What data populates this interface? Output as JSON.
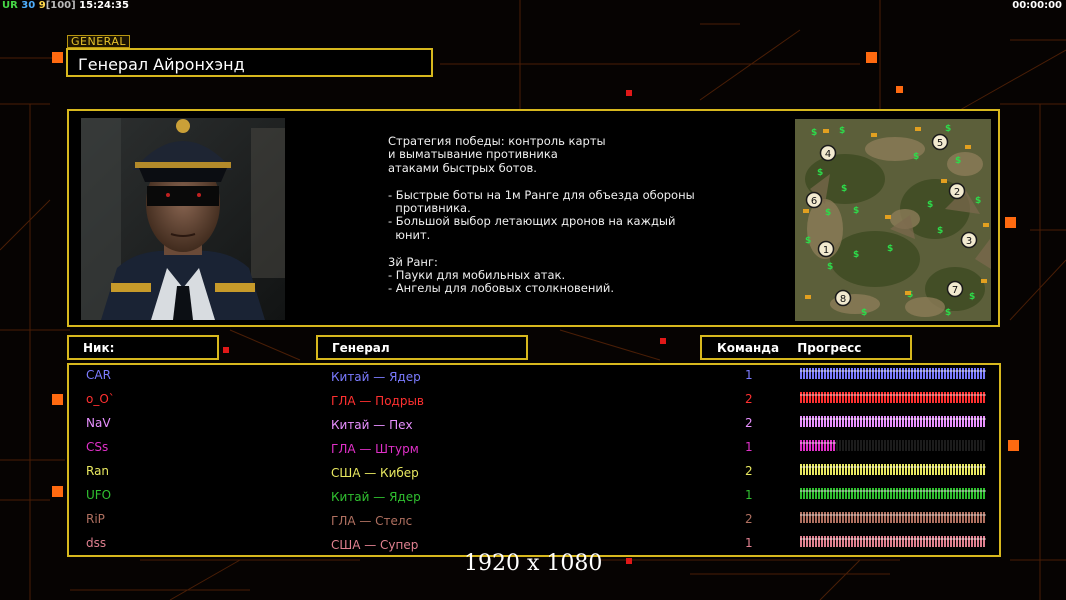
{
  "hud": {
    "segments": [
      {
        "text": "UR",
        "color": "#46d646"
      },
      {
        "text": " 30 ",
        "color": "#4fb0ff"
      },
      {
        "text": "9",
        "color": "#ffd84a"
      },
      {
        "text": "[100]",
        "color": "#bbbbbb"
      },
      {
        "text": " 15:24:35",
        "color": "#ffffff"
      }
    ],
    "timer": "00:00:00"
  },
  "general": {
    "tag": "GENERAL",
    "name": "Генерал Айронхэнд"
  },
  "description": "Стратегия победы: контроль карты\nи выматывание противника\nатаками быстрых ботов.\n\n- Быстрые боты на 1м Ранге для объезда обороны\n  противника.\n- Большой выбор летающих дронов на каждый\n  юнит.\n\n3й Ранг:\n- Пауки для мобильных атак.\n- Ангелы для лобовых столкновений.",
  "minimap": {
    "spawns": [
      "1",
      "2",
      "3",
      "4",
      "5",
      "6",
      "7",
      "8"
    ]
  },
  "headers": {
    "nick": "Ник:",
    "general": "Генерал",
    "team": "Команда",
    "progress": "Прогресс"
  },
  "players": [
    {
      "nick": "CAR",
      "general": "Китай — Ядер",
      "team": "1",
      "progress": 1.0,
      "color": "#7b7bff"
    },
    {
      "nick": "o_O`",
      "general": "ГЛА — Подрыв",
      "team": "2",
      "progress": 1.0,
      "color": "#ff3030"
    },
    {
      "nick": "NaV",
      "general": "Китай — Пех",
      "team": "2",
      "progress": 1.0,
      "color": "#e890ff"
    },
    {
      "nick": "CSs",
      "general": "ГЛА — Штурм",
      "team": "1",
      "progress": 0.2,
      "color": "#e030c8"
    },
    {
      "nick": "Ran",
      "general": "США — Кибер",
      "team": "2",
      "progress": 1.0,
      "color": "#e8e860"
    },
    {
      "nick": "UFO",
      "general": "Китай — Ядер",
      "team": "1",
      "progress": 1.0,
      "color": "#30c030"
    },
    {
      "nick": "RiP",
      "general": "ГЛА — Стелс",
      "team": "2",
      "progress": 1.0,
      "color": "#b07060"
    },
    {
      "nick": "dss",
      "general": "США — Супер",
      "team": "1",
      "progress": 1.0,
      "color": "#e08090"
    }
  ],
  "resolution": "1920 x 1080",
  "colors": {
    "frame": "#d7b81e",
    "grid": "#5a2608",
    "accent": "#ff6a10"
  }
}
